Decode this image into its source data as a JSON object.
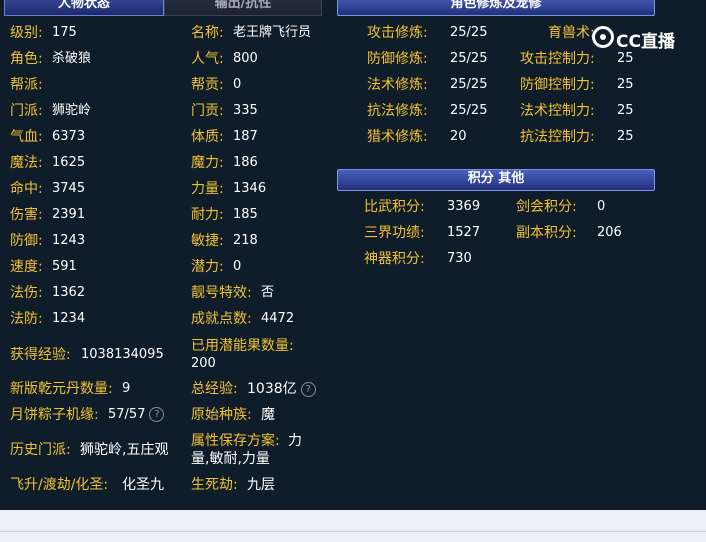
{
  "tabs": {
    "active": "人物状态",
    "inactive": "输出/抗性"
  },
  "left_col1": [
    {
      "label": "级别:",
      "value": "175"
    },
    {
      "label": "角色:",
      "value": "杀破狼"
    },
    {
      "label": "帮派:",
      "value": ""
    },
    {
      "label": "门派:",
      "value": "狮驼岭"
    },
    {
      "label": "气血:",
      "value": "6373"
    },
    {
      "label": "魔法:",
      "value": "1625"
    },
    {
      "label": "命中:",
      "value": "3745"
    },
    {
      "label": "伤害:",
      "value": "2391"
    },
    {
      "label": "防御:",
      "value": "1243"
    },
    {
      "label": "速度:",
      "value": "591"
    },
    {
      "label": "法伤:",
      "value": "1362"
    },
    {
      "label": "法防:",
      "value": "1234"
    }
  ],
  "left_col2": [
    {
      "label": "名称:",
      "value": "老王牌飞行员"
    },
    {
      "label": "人气:",
      "value": "800"
    },
    {
      "label": "帮贡:",
      "value": "0"
    },
    {
      "label": "门贡:",
      "value": "335"
    },
    {
      "label": "体质:",
      "value": "187"
    },
    {
      "label": "魔力:",
      "value": "186"
    },
    {
      "label": "力量:",
      "value": "1346"
    },
    {
      "label": "耐力:",
      "value": "185"
    },
    {
      "label": "敏捷:",
      "value": "218"
    },
    {
      "label": "潜力:",
      "value": "0"
    },
    {
      "label": "靓号特效:",
      "value": "否"
    },
    {
      "label": "成就点数:",
      "value": "4472"
    }
  ],
  "extra": {
    "exp_label": "获得经验:",
    "exp_value": "1038134095",
    "used_potential_label": "已用潜能果数量:",
    "used_potential_value": "200",
    "qianyuan_label": "新版乾元丹数量:",
    "qianyuan_value": "9",
    "total_exp_label": "总经验:",
    "total_exp_value": "1038亿",
    "mooncake_label": "月饼粽子机缘:",
    "mooncake_value": "57/57",
    "race_label": "原始种族:",
    "race_value": "魔",
    "history_label": "历史门派:",
    "history_value": "狮驼岭,五庄观",
    "scheme_label": "属性保存方案:",
    "scheme_value_line1": "力",
    "scheme_value_line2": "量,敏耐,力量",
    "fly_label": "飞升/渡劫/化圣:",
    "fly_value": "化圣九",
    "life_label": "生死劫:",
    "life_value": "九层",
    "help_glyph": "?"
  },
  "cultivation": {
    "header": "角色修炼及宠修",
    "rows": [
      {
        "label": "攻击修炼:",
        "value": "25/25",
        "label2": "育兽术:",
        "value2": ""
      },
      {
        "label": "防御修炼:",
        "value": "25/25",
        "label2": "攻击控制力:",
        "value2": "25"
      },
      {
        "label": "法术修炼:",
        "value": "25/25",
        "label2": "防御控制力:",
        "value2": "25"
      },
      {
        "label": "抗法修炼:",
        "value": "25/25",
        "label2": "法术控制力:",
        "value2": "25"
      },
      {
        "label": "猎术修炼:",
        "value": "20",
        "label2": "抗法控制力:",
        "value2": "25"
      }
    ]
  },
  "points": {
    "header": "积分 其他",
    "rows": [
      {
        "label": "比武积分:",
        "value": "3369",
        "label2": "剑会积分:",
        "value2": "0"
      },
      {
        "label": "三界功绩:",
        "value": "1527",
        "label2": "副本积分:",
        "value2": "206"
      },
      {
        "label": "神器积分:",
        "value": "730",
        "label2": "",
        "value2": ""
      }
    ]
  },
  "watermark": {
    "text": "CC直播",
    "icon": "cc-logo-icon"
  }
}
